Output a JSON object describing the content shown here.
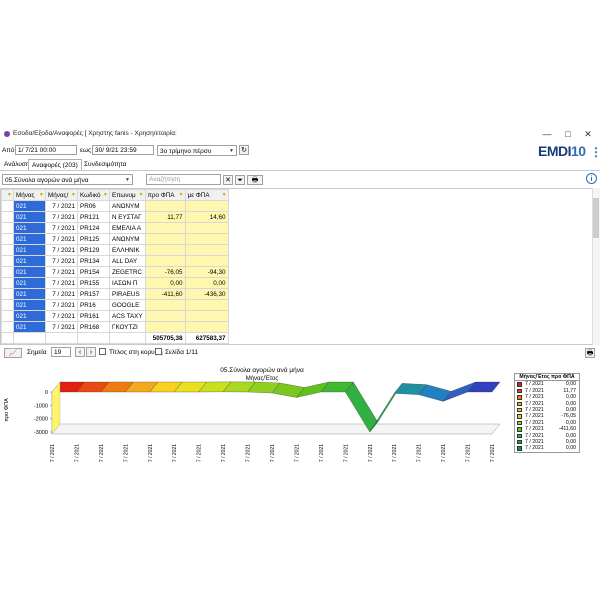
{
  "window": {
    "title": "Εσοδα/Εξοδα/Αναφορές  [ Χρηστης fanis - Χρηση/εταιρία:",
    "min_glyph": "—",
    "max_glyph": "□",
    "close_glyph": "✕"
  },
  "brand": {
    "text1": "EMDI",
    "text2": "10"
  },
  "filters": {
    "from_label": "Από",
    "from_value": "1/  7/21 00:00",
    "to_label": "εως",
    "to_value": "30/  9/21 23:59",
    "period_value": "3ο τρίμηνο πέρσυ"
  },
  "tabs": [
    {
      "label": "Ανάλυση"
    },
    {
      "label": "Αναφορές (203)"
    },
    {
      "label": "Συνδεσιμότητα"
    }
  ],
  "report": {
    "selected": "05.Σύνολα αγορών ανά μήνα",
    "search_placeholder": "Αναζήτηση"
  },
  "table": {
    "columns": [
      "Μήνας",
      "Μήνας/",
      "Κωδικό",
      "Επωνυμ",
      "προ ΦΠΑ",
      "με ΦΠΑ"
    ],
    "rows": [
      [
        "021",
        "7 / 2021",
        "PR06",
        "ΑΝΩΝΥΜ",
        "",
        ""
      ],
      [
        "021",
        "7 / 2021",
        "PR121",
        "Ν ΕΥΣΤΑΓ",
        "11,77",
        "14,60"
      ],
      [
        "021",
        "7 / 2021",
        "PR124",
        "ΕΜΕΛΙΑ Α",
        "",
        ""
      ],
      [
        "021",
        "7 / 2021",
        "PR125",
        "ΑΝΩΝΥΜ",
        "",
        ""
      ],
      [
        "021",
        "7 / 2021",
        "PR129",
        "ΕΛΛΗΝΙΚ",
        "",
        ""
      ],
      [
        "021",
        "7 / 2021",
        "PR134",
        "ALL DAY",
        "",
        ""
      ],
      [
        "021",
        "7 / 2021",
        "PR154",
        "ZEGETRC",
        "-76,05",
        "-94,30"
      ],
      [
        "021",
        "7 / 2021",
        "PR155",
        "ΙΑΣΩΝ Π",
        "0,00",
        "0,00"
      ],
      [
        "021",
        "7 / 2021",
        "PR157",
        "PIRAEUS",
        "-411,60",
        "-436,30"
      ],
      [
        "021",
        "7 / 2021",
        "PR16",
        "GOOGLE",
        "",
        ""
      ],
      [
        "021",
        "7 / 2021",
        "PR161",
        "ACS TAXY",
        "",
        ""
      ],
      [
        "021",
        "7 / 2021",
        "PR168",
        "ΓΚΟΥΤΖΙ",
        "",
        ""
      ]
    ],
    "totals": {
      "pre_vat": "505705,38",
      "with_vat": "627583,37"
    }
  },
  "chart_toolbar": {
    "points_label": "Σημεία",
    "points_value": "19",
    "title_top_label": "Τίτλος στη κορυφή",
    "page_label": "Σελίδα 1/11"
  },
  "chart_data": {
    "type": "area",
    "title": "05.Σύνολα αγορών ανά μήνα",
    "subtitle": "Μήνας/Έτος",
    "ylabel": "προ ΦΠΑ",
    "xlabel": "",
    "ylim": [
      -3000,
      0
    ],
    "yticks": [
      0,
      -1000,
      -2000,
      -3000
    ],
    "tick_labels_y": [
      "0",
      "-1000",
      "-2000",
      "-3000"
    ],
    "categories": [
      "7 / 2021",
      "7 / 2021",
      "7 / 2021",
      "7 / 2021",
      "7 / 2021",
      "7 / 2021",
      "7 / 2021",
      "7 / 2021",
      "7 / 2021",
      "7 / 2021",
      "7 / 2021",
      "7 / 2021",
      "7 / 2021",
      "7 / 2021",
      "7 / 2021",
      "7 / 2021",
      "7 / 2021",
      "7 / 2021",
      "7 / 2021"
    ],
    "values": [
      0,
      0,
      0,
      0,
      0,
      0,
      0,
      11.77,
      0,
      -76.05,
      -411.6,
      0,
      0,
      -3000,
      -100,
      -200,
      -700,
      0,
      0
    ],
    "grid": false,
    "legend_position": "right",
    "legend_title": "Μήνας/Έτος προ ΦΠΑ",
    "legend": [
      {
        "label": "7 / 2021",
        "value": "0,00",
        "color": "#e02010"
      },
      {
        "label": "7 / 2021",
        "value": "11,77",
        "color": "#e84a10"
      },
      {
        "label": "7 / 2021",
        "value": "0,00",
        "color": "#f07a10"
      },
      {
        "label": "7 / 2021",
        "value": "0,00",
        "color": "#f4a820"
      },
      {
        "label": "7 / 2021",
        "value": "0,00",
        "color": "#e8d020"
      },
      {
        "label": "7 / 2021",
        "value": "-76,05",
        "color": "#c8d820"
      },
      {
        "label": "7 / 2021",
        "value": "0,00",
        "color": "#a0d020"
      },
      {
        "label": "7 / 2021",
        "value": "-411,60",
        "color": "#70c020"
      },
      {
        "label": "7 / 2021",
        "value": "0,00",
        "color": "#40b020"
      },
      {
        "label": "7 / 2021",
        "value": "0,00",
        "color": "#20a040"
      },
      {
        "label": "7 / 2021",
        "value": "0,00",
        "color": "#109050"
      }
    ],
    "colors": [
      "#e02010",
      "#e84a10",
      "#f07a10",
      "#f4a820",
      "#f8d020",
      "#e8e020",
      "#c8e020",
      "#a8d820",
      "#90d020",
      "#78c820",
      "#60c020",
      "#40b830",
      "#30b040",
      "#20a050",
      "#2090a0",
      "#2080c0",
      "#3060c0",
      "#3040c0",
      "#2030c0"
    ]
  }
}
